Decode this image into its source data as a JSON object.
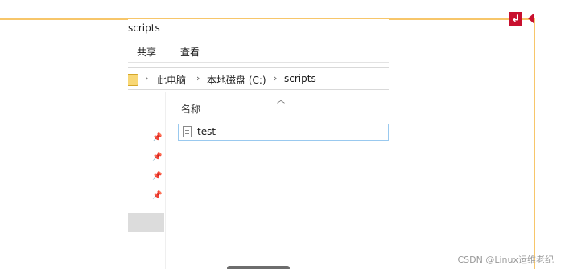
{
  "window": {
    "title": "scripts"
  },
  "ribbon": {
    "tabs": [
      {
        "label": "共享"
      },
      {
        "label": "查看"
      }
    ]
  },
  "address": {
    "breadcrumbs": [
      "此电脑",
      "本地磁盘 (C:)",
      "scripts"
    ],
    "separator": "›"
  },
  "list": {
    "columns": [
      {
        "label": "名称",
        "sorted": "ascending"
      }
    ],
    "files": [
      {
        "name": "test",
        "selected": true
      }
    ]
  },
  "nav": {
    "pins": 4,
    "pin_icon": "pin-icon"
  },
  "frame_marker": "↲",
  "watermark": "CSDN @Linux运维老纪",
  "colors": {
    "frame": "#f7c66a",
    "marker": "#c8102e",
    "selection_border": "#99c9ef",
    "folder": "#f8d775"
  }
}
